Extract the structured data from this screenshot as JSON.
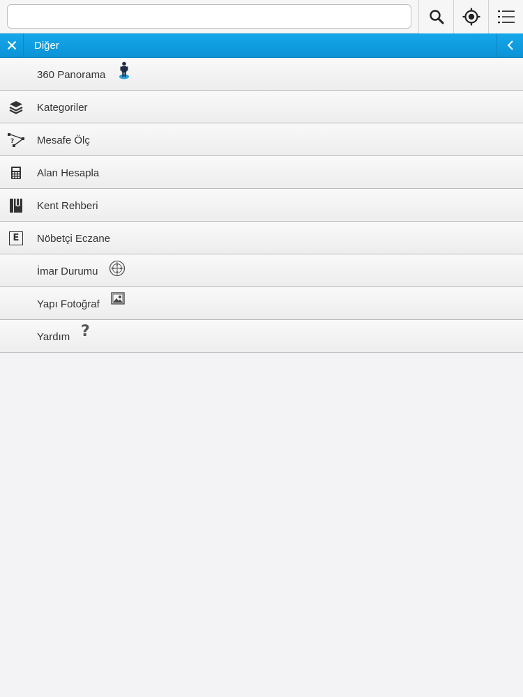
{
  "search": {
    "value": "",
    "placeholder": ""
  },
  "toolbar": {
    "buttons": [
      {
        "icon": "search-icon"
      },
      {
        "icon": "locate-icon"
      },
      {
        "icon": "list-menu-icon"
      }
    ]
  },
  "panel": {
    "title": "Diğer",
    "close_icon": "close-icon",
    "back_icon": "chevron-left-icon"
  },
  "menu": {
    "items": [
      {
        "label": "360 Panorama",
        "icon": "pegman-icon"
      },
      {
        "label": "Kategoriler",
        "icon": "layers-icon"
      },
      {
        "label": "Mesafe Ölç",
        "icon": "measure-distance-icon"
      },
      {
        "label": "Alan Hesapla",
        "icon": "calculator-icon"
      },
      {
        "label": "Kent Rehberi",
        "icon": "city-guide-book-icon"
      },
      {
        "label": "Nöbetçi Eczane",
        "icon": "pharmacy-e-icon",
        "icon_text": "E"
      },
      {
        "label": "İmar Durumu",
        "icon": "zoning-compass-icon"
      },
      {
        "label": "Yapı Fotoğraf",
        "icon": "photo-icon"
      },
      {
        "label": "Yardım",
        "icon": "help-icon",
        "icon_text": "?"
      }
    ]
  },
  "colors": {
    "header_blue": "#0b93d6",
    "pegman_blue": "#2aa0d8",
    "background": "#f3f3f5"
  }
}
